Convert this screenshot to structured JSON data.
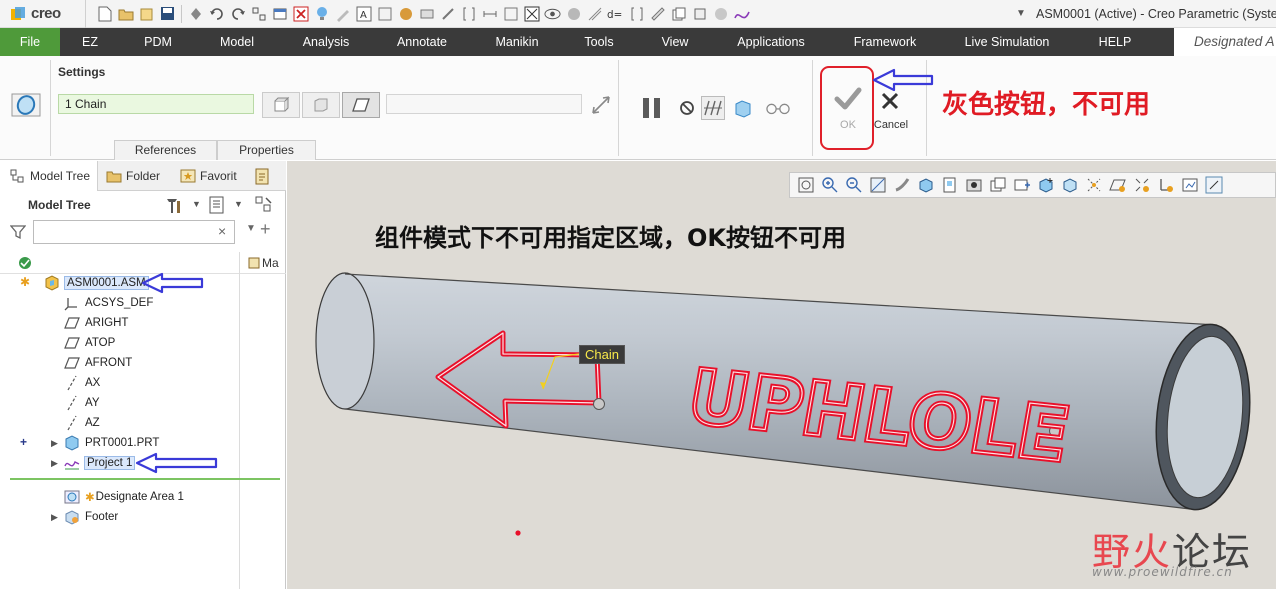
{
  "app": {
    "logo": "creo",
    "window_title": "ASM0001 (Active) - Creo Parametric (System"
  },
  "menu": {
    "items": [
      "File",
      "EZ",
      "PDM",
      "Model",
      "Analysis",
      "Annotate",
      "Manikin",
      "Tools",
      "View",
      "Applications",
      "Framework",
      "Live Simulation",
      "HELP"
    ],
    "right_label": "Designated A"
  },
  "ribbon": {
    "settings_label": "Settings",
    "chain_value": "1 Chain",
    "tabs": [
      "References",
      "Properties"
    ],
    "ok_label": "OK",
    "cancel_label": "Cancel",
    "ok_enabled": false,
    "annotation": "灰色按钮，不可用"
  },
  "panel": {
    "tabs": [
      "Model Tree",
      "Folder",
      "Favorit"
    ],
    "title": "Model Tree",
    "filter_value": "",
    "column_label": "Ma",
    "items": [
      {
        "label": "ASM0001.ASM",
        "icon": "assembly-icon"
      },
      {
        "label": "ACSYS_DEF",
        "icon": "csys-icon"
      },
      {
        "label": "ARIGHT",
        "icon": "datum-plane-icon"
      },
      {
        "label": "ATOP",
        "icon": "datum-plane-icon"
      },
      {
        "label": "AFRONT",
        "icon": "datum-plane-icon"
      },
      {
        "label": "AX",
        "icon": "datum-axis-icon"
      },
      {
        "label": "AY",
        "icon": "datum-axis-icon"
      },
      {
        "label": "AZ",
        "icon": "datum-axis-icon"
      },
      {
        "label": "PRT0001.PRT",
        "icon": "part-icon"
      },
      {
        "label": "Project 1",
        "icon": "project-curve-icon"
      },
      {
        "label": "Designate Area 1",
        "icon": "designate-area-icon"
      },
      {
        "label": "Footer",
        "icon": "footer-icon"
      }
    ]
  },
  "graphics": {
    "annotation": "组件模式下不可用指定区域，OK按钮不可用",
    "chain_tag": "Chain",
    "text_on_pipe": "UPHLOLE",
    "watermark_cn_1": "野火",
    "watermark_cn_2": "论坛",
    "watermark_url": "www.proewildfire.cn"
  },
  "colors": {
    "file_tab": "#4f9a3a",
    "menubar": "#3a3a3a",
    "annotation_red": "#e01b24",
    "arrow_blue": "#3a3ad8",
    "chain_sketch": "#e8102a"
  }
}
